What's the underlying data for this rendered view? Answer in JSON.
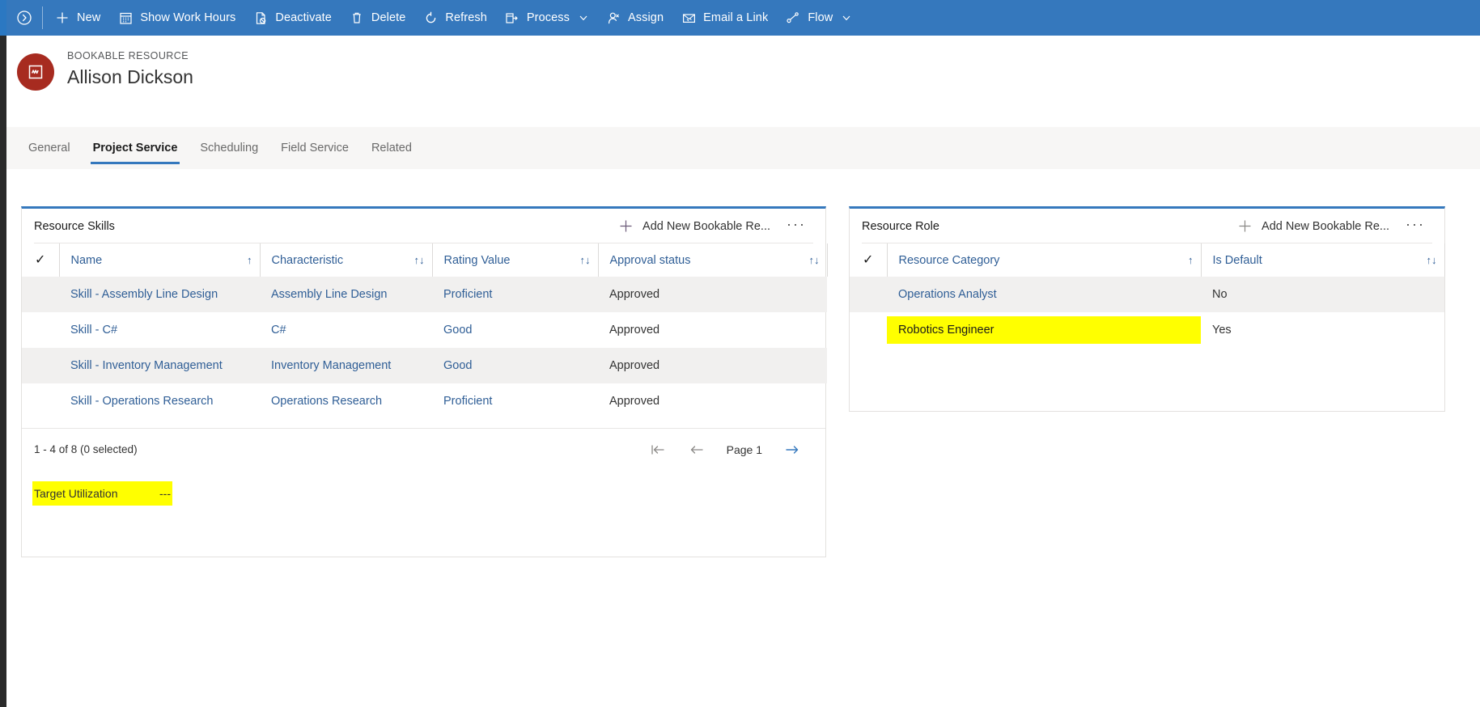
{
  "commandbar": {
    "expand_icon": "chevron-right-circle-icon",
    "items": [
      {
        "label": "New",
        "icon": "plus-icon",
        "chevron": false
      },
      {
        "label": "Show Work Hours",
        "icon": "calendar-icon",
        "chevron": false
      },
      {
        "label": "Deactivate",
        "icon": "file-block-icon",
        "chevron": false
      },
      {
        "label": "Delete",
        "icon": "trash-icon",
        "chevron": false
      },
      {
        "label": "Refresh",
        "icon": "refresh-icon",
        "chevron": false
      },
      {
        "label": "Process",
        "icon": "process-icon",
        "chevron": true
      },
      {
        "label": "Assign",
        "icon": "person-icon",
        "chevron": false
      },
      {
        "label": "Email a Link",
        "icon": "email-link-icon",
        "chevron": false
      },
      {
        "label": "Flow",
        "icon": "flow-icon",
        "chevron": true
      }
    ]
  },
  "record_header": {
    "entity_label": "BOOKABLE RESOURCE",
    "record_name": "Allison Dickson",
    "avatar_icon": "bookable-resource-icon",
    "avatar_color": "#a72b20"
  },
  "tabs": [
    {
      "label": "General",
      "active": false
    },
    {
      "label": "Project Service",
      "active": true
    },
    {
      "label": "Scheduling",
      "active": false
    },
    {
      "label": "Field Service",
      "active": false
    },
    {
      "label": "Related",
      "active": false
    }
  ],
  "accent_color": "#3578bd",
  "highlight_color": "#ffff00",
  "resource_skills": {
    "title": "Resource Skills",
    "add_label": "Add New Bookable Re...",
    "add_icon": "plus-icon",
    "more_icon": "ellipsis-icon",
    "select_all_icon": "checkmark-icon",
    "columns": [
      {
        "label": "Name",
        "sort": "↑"
      },
      {
        "label": "Characteristic",
        "sort": "↑↓"
      },
      {
        "label": "Rating Value",
        "sort": "↑↓"
      },
      {
        "label": "Approval status",
        "sort": "↑↓"
      }
    ],
    "rows": [
      {
        "name": "Skill - Assembly Line Design",
        "characteristic": "Assembly Line Design",
        "rating": "Proficient",
        "approval": "Approved"
      },
      {
        "name": "Skill - C#",
        "characteristic": "C#",
        "rating": "Good",
        "approval": "Approved"
      },
      {
        "name": "Skill - Inventory Management",
        "characteristic": "Inventory Management",
        "rating": "Good",
        "approval": "Approved"
      },
      {
        "name": "Skill - Operations Research",
        "characteristic": "Operations Research",
        "rating": "Proficient",
        "approval": "Approved"
      }
    ],
    "footer": {
      "count_text": "1 - 4 of 8 (0 selected)",
      "first_icon": "page-first-icon",
      "prev_icon": "page-prev-icon",
      "page_label": "Page 1",
      "next_icon": "page-next-icon"
    }
  },
  "target_utilization": {
    "label": "Target Utilization",
    "value": "---",
    "highlighted": true
  },
  "resource_role": {
    "title": "Resource Role",
    "add_label": "Add New Bookable Re...",
    "add_icon": "plus-icon",
    "more_icon": "ellipsis-icon",
    "select_all_icon": "checkmark-icon",
    "columns": [
      {
        "label": "Resource Category",
        "sort": "↑"
      },
      {
        "label": "Is Default",
        "sort": "↑↓"
      }
    ],
    "rows": [
      {
        "category": "Operations Analyst",
        "is_default": "No",
        "highlighted": false
      },
      {
        "category": "Robotics Engineer",
        "is_default": "Yes",
        "highlighted": true
      }
    ]
  }
}
